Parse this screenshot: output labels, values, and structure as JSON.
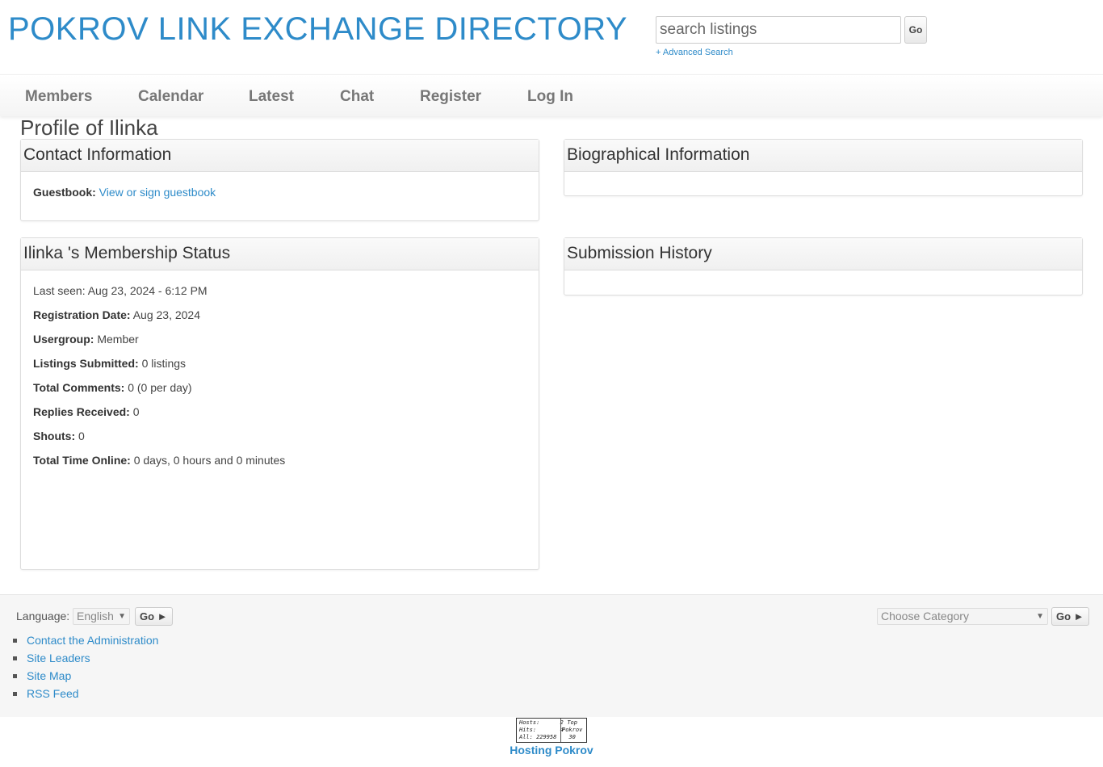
{
  "header": {
    "site_title": "POKROV LINK EXCHANGE DIRECTORY",
    "search_placeholder": "search listings",
    "search_go": "Go",
    "advanced_search": "+ Advanced Search"
  },
  "nav": {
    "items": [
      "Members",
      "Calendar",
      "Latest",
      "Chat",
      "Register",
      "Log In"
    ]
  },
  "page_title": "Profile of Ilinka",
  "contact": {
    "heading": "Contact Information",
    "guestbook_label": "Guestbook:",
    "guestbook_link": "View or sign guestbook"
  },
  "bio": {
    "heading": "Biographical Information"
  },
  "membership": {
    "heading": "Ilinka 's Membership Status",
    "last_seen": "Last seen: Aug 23, 2024 - 6:12 PM",
    "rows": [
      {
        "label": "Registration Date:",
        "value": "Aug 23, 2024"
      },
      {
        "label": "Usergroup:",
        "value": "Member"
      },
      {
        "label": "Listings Submitted:",
        "value": "0 listings"
      },
      {
        "label": "Total Comments:",
        "value": "0 (0 per day)"
      },
      {
        "label": "Replies Received:",
        "value": "0"
      },
      {
        "label": "Shouts:",
        "value": "0"
      },
      {
        "label": "Total Time Online:",
        "value": "0 days, 0 hours and 0 minutes"
      }
    ]
  },
  "submission": {
    "heading": "Submission History"
  },
  "footer": {
    "language_label": "Language:",
    "language_value": "English",
    "language_go": "Go ►",
    "category_value": "Choose Category",
    "category_go": "Go ►",
    "links": [
      "Contact the Administration",
      "Site Leaders",
      "Site Map",
      "RSS Feed"
    ],
    "counter": {
      "hosts_label": "Hosts:",
      "hosts_value": "2",
      "hits_label": "Hits:",
      "hits_value": "4",
      "all_label": "All:",
      "all_value": "229958",
      "top_label": "Top",
      "top_name": "Pokrov",
      "top_value": "30"
    },
    "hosting": "Hosting Pokrov"
  },
  "colors": {
    "accent": "#2e8bc9",
    "nav_text": "#777777"
  }
}
